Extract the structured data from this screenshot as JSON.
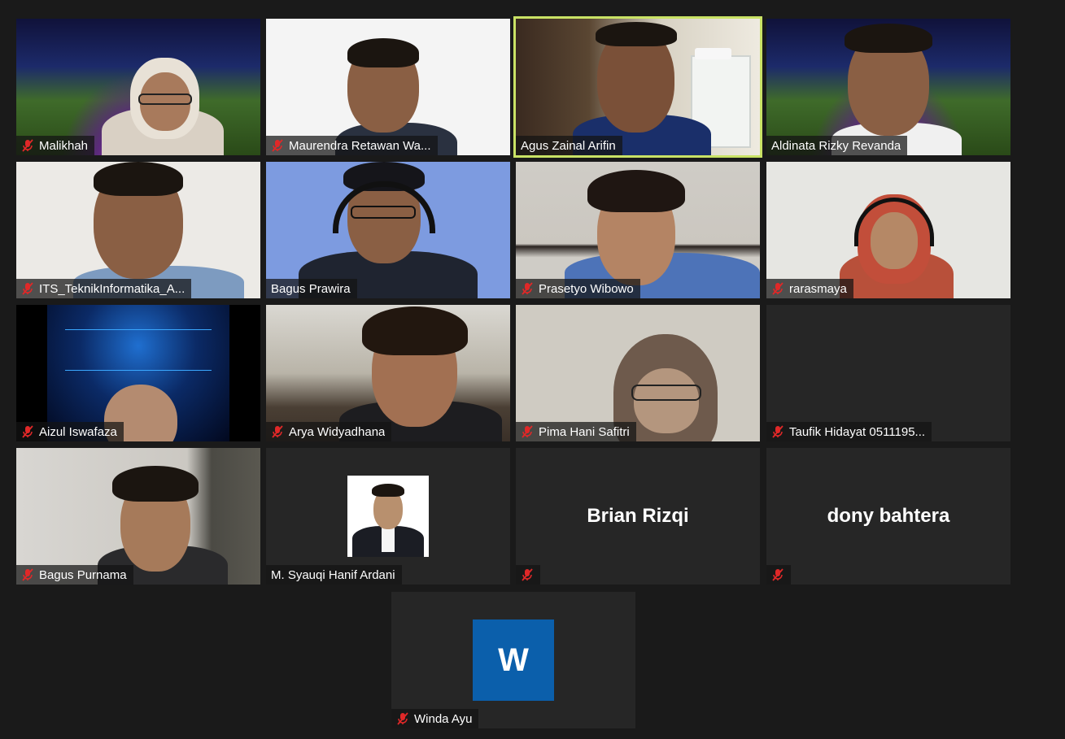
{
  "colors": {
    "background": "#1a1a1a",
    "tile": "#262626",
    "active_speaker_border": "#c9e265",
    "mute_red": "#e02828",
    "avatar_blue": "#0b5fab"
  },
  "participants": [
    {
      "name": "Malikhah",
      "muted": true
    },
    {
      "name": "Maurendra Retawan Wa...",
      "muted": true
    },
    {
      "name": "Agus Zainal Arifin",
      "muted": false,
      "active_speaker": true
    },
    {
      "name": "Aldinata Rizky Revanda",
      "muted": false
    },
    {
      "name": "ITS_TeknikInformatika_A...",
      "muted": true
    },
    {
      "name": "Bagus Prawira",
      "muted": false
    },
    {
      "name": "Prasetyo Wibowo",
      "muted": true
    },
    {
      "name": "rarasmaya",
      "muted": true
    },
    {
      "name": "Aizul Iswafaza",
      "muted": true
    },
    {
      "name": "Arya Widyadhana",
      "muted": true
    },
    {
      "name": "Pima Hani Safitri",
      "muted": true
    },
    {
      "name": "Taufik Hidayat 0511195...",
      "muted": true,
      "video_off": true
    },
    {
      "name": "Bagus Purnama",
      "muted": true
    },
    {
      "name": "M. Syauqi Hanif Ardani",
      "muted": false,
      "profile_photo": true
    },
    {
      "name": "",
      "display_name": "Brian Rizqi",
      "muted": true,
      "video_off": true
    },
    {
      "name": "",
      "display_name": "dony bahtera",
      "muted": true,
      "video_off": true
    },
    {
      "name": "Winda Ayu",
      "muted": true,
      "avatar_letter": "W"
    }
  ]
}
